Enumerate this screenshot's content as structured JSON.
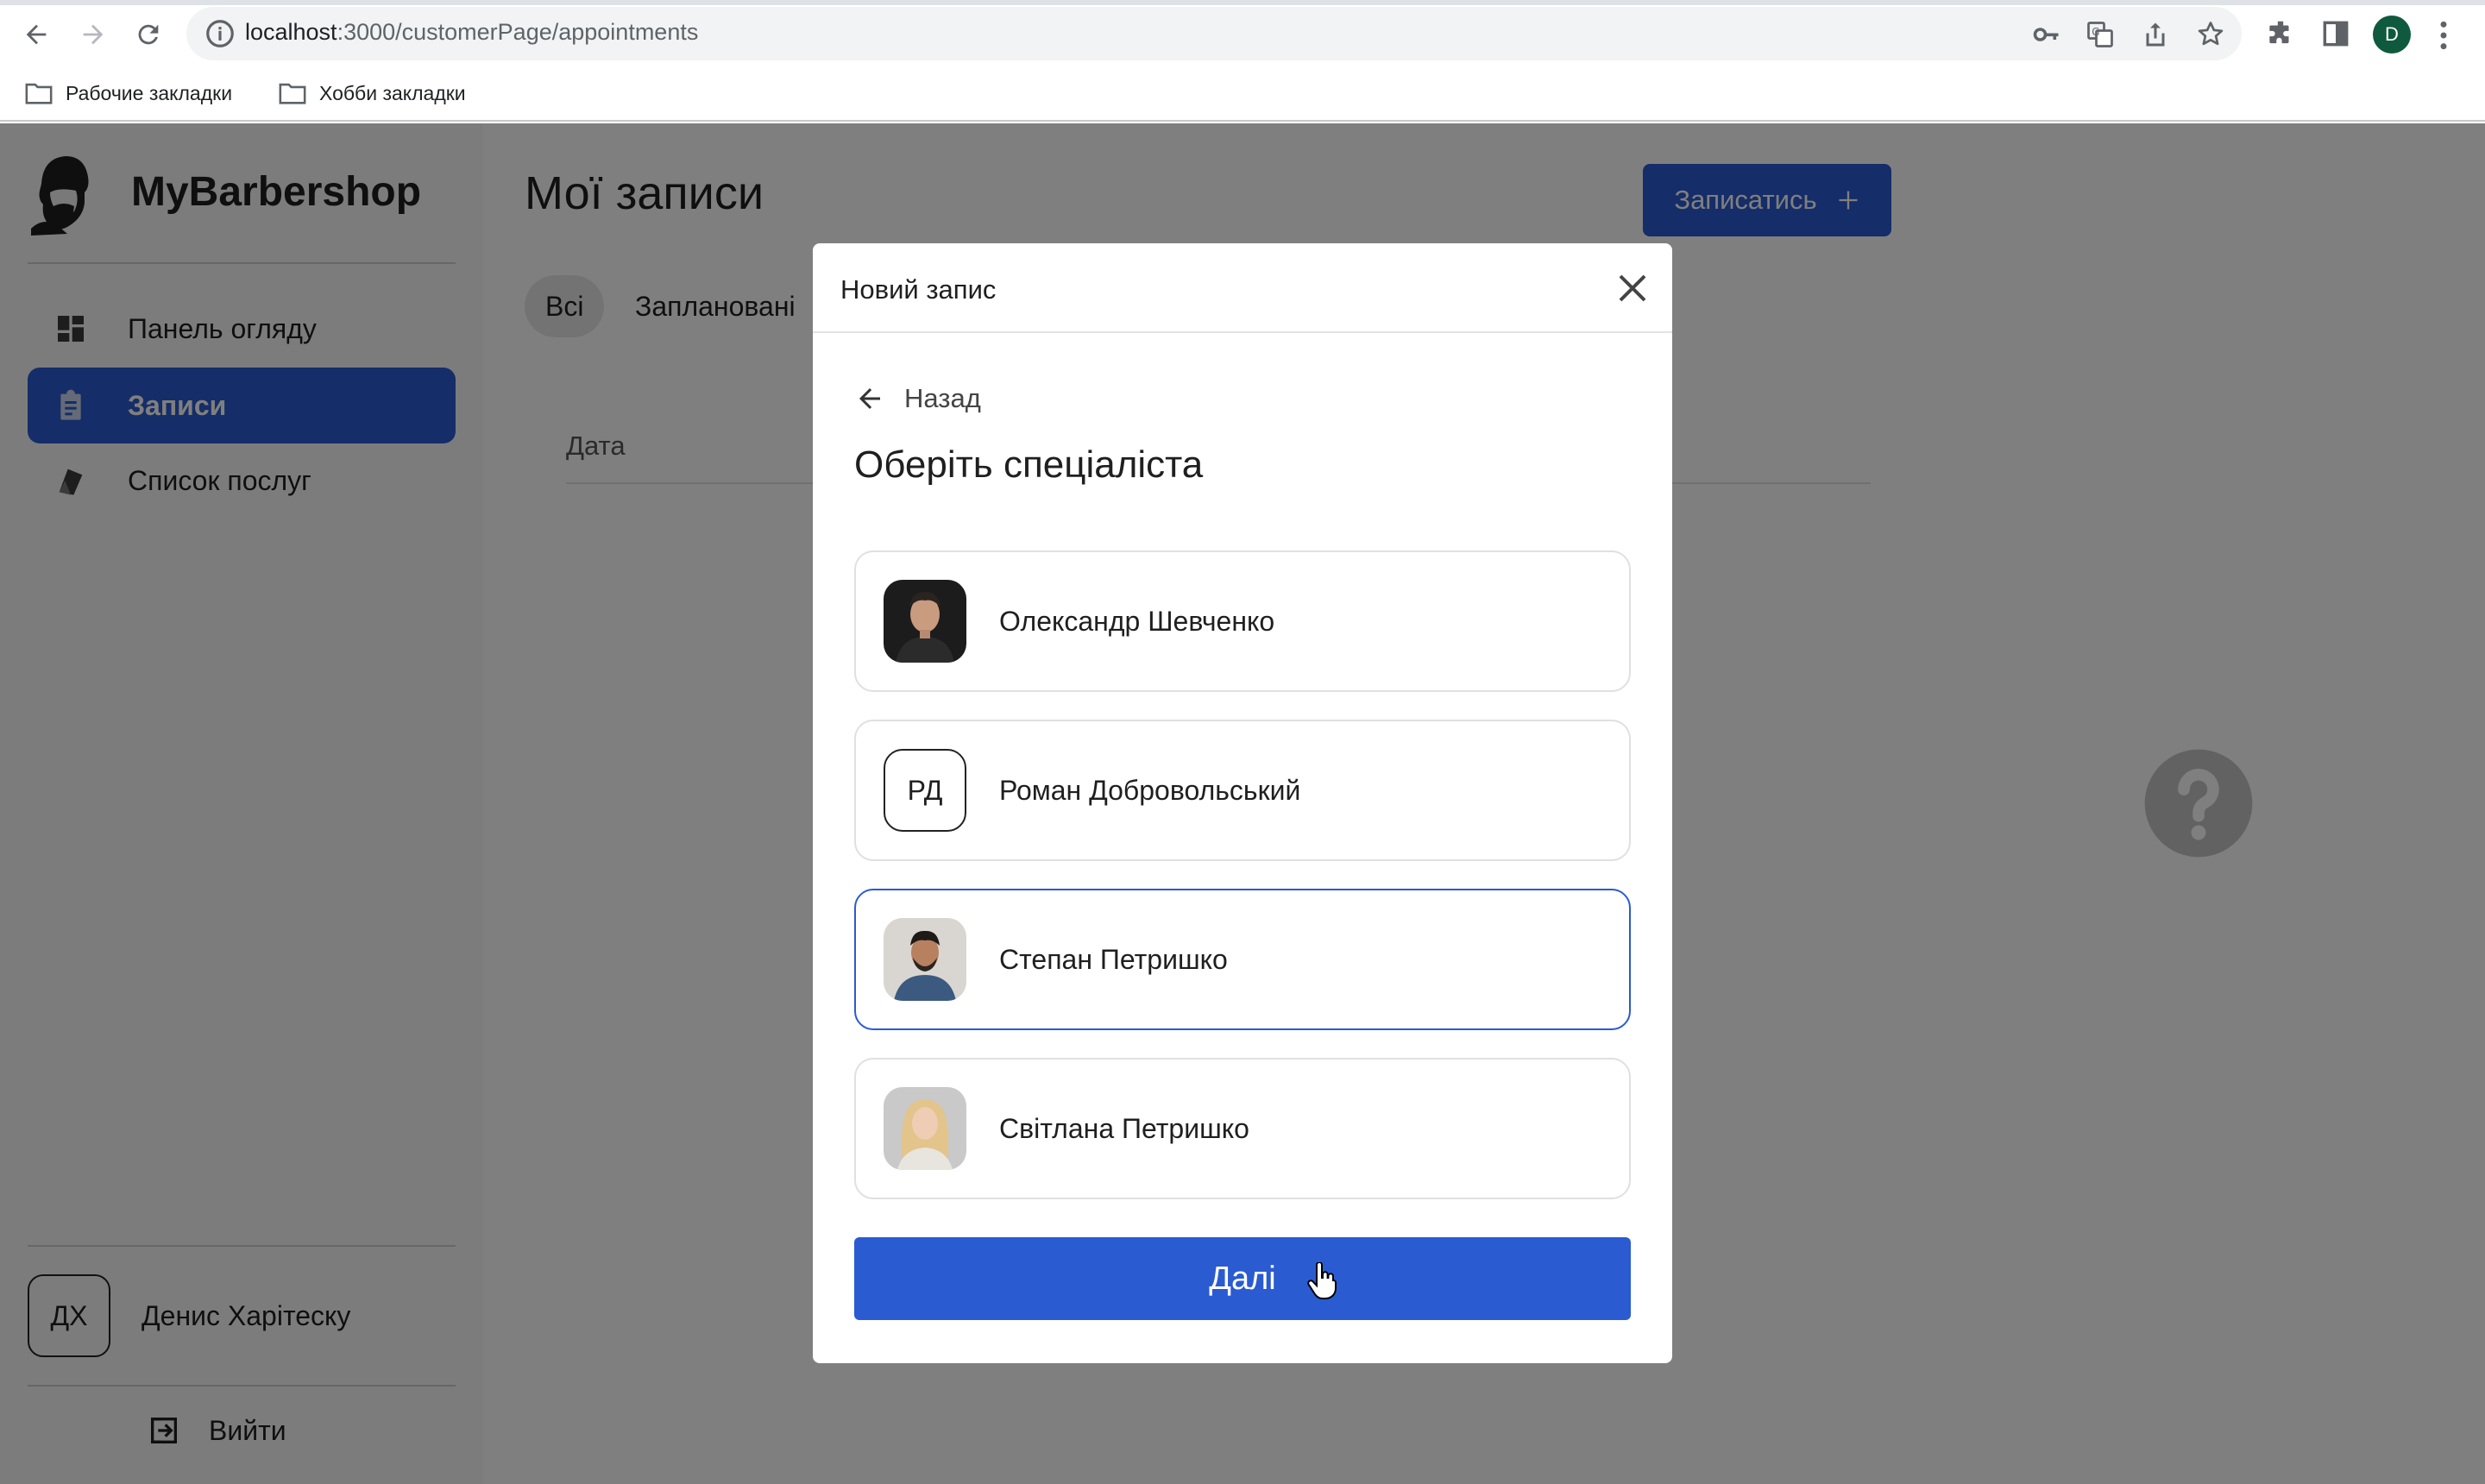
{
  "browser": {
    "url_host": "localhost",
    "url_rest": ":3000/customerPage/appointments",
    "profile_initial": "D",
    "bookmarks": [
      "Рабочие закладки",
      "Хобби закладки"
    ]
  },
  "sidebar": {
    "brand": "MyBarbershop",
    "items": [
      {
        "label": "Панель огляду",
        "icon": "dashboard-icon"
      },
      {
        "label": "Записи",
        "icon": "clipboard-icon",
        "active": true
      },
      {
        "label": "Список послуг",
        "icon": "services-icon"
      }
    ],
    "user": {
      "initials": "ДХ",
      "name": "Денис Харітеску"
    },
    "logout_label": "Вийти"
  },
  "main": {
    "title": "Мої записи",
    "book_button": "Записатись",
    "filters": [
      "Всі",
      "Заплановані"
    ],
    "table_header_date": "Дата"
  },
  "modal": {
    "title": "Новий запис",
    "back_label": "Назад",
    "heading": "Оберіть спеціаліста",
    "specialists": [
      {
        "name": "Олександр Шевченко",
        "avatar": "photo"
      },
      {
        "name": "Роман Добровольський",
        "initials": "РД"
      },
      {
        "name": "Степан Петришко",
        "avatar": "photo",
        "selected": true
      },
      {
        "name": "Світлана Петришко",
        "avatar": "photo"
      }
    ],
    "next_button": "Далі"
  },
  "colors": {
    "accent": "#2a5bd1",
    "overlay": "rgba(0,0,0,0.5)"
  }
}
